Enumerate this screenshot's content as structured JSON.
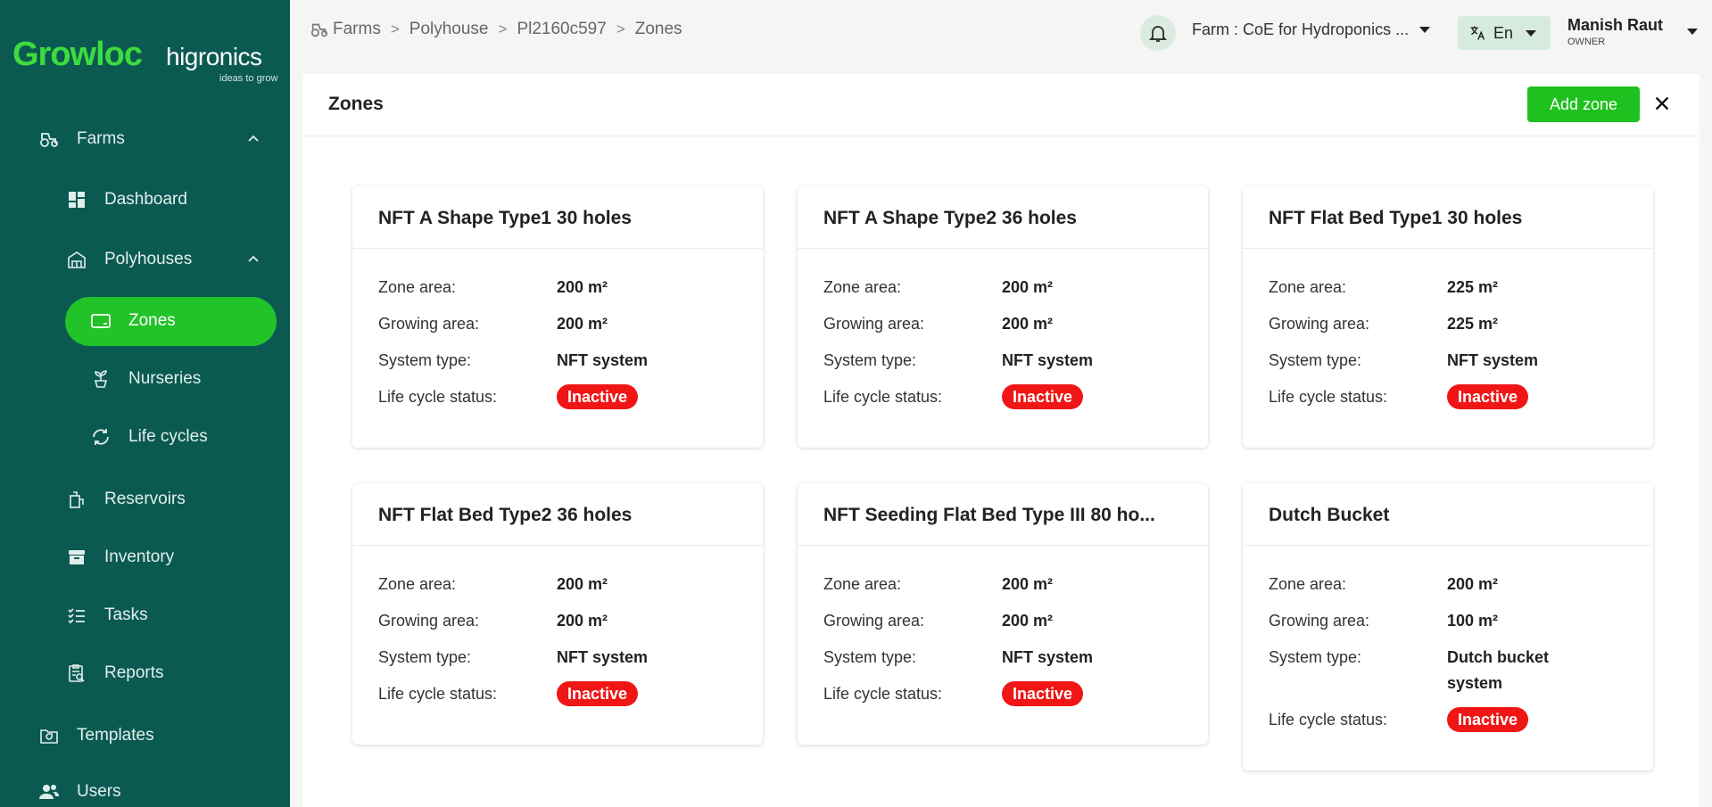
{
  "brand": {
    "name_part1": "Growloc",
    "name_part2": "higronics",
    "tagline": "ideas to grow",
    "accent": "#22c229",
    "sidebar_bg": "#0b5a52"
  },
  "sidebar": {
    "items": [
      {
        "label": "Farms",
        "icon": "tractor-icon"
      },
      {
        "label": "Dashboard",
        "icon": "dashboard-icon"
      },
      {
        "label": "Polyhouses",
        "icon": "polyhouse-icon"
      },
      {
        "label": "Zones",
        "icon": "zone-icon",
        "active": true
      },
      {
        "label": "Nurseries",
        "icon": "sprout-icon"
      },
      {
        "label": "Life cycles",
        "icon": "cycle-icon"
      },
      {
        "label": "Reservoirs",
        "icon": "reservoir-icon"
      },
      {
        "label": "Inventory",
        "icon": "archive-icon"
      },
      {
        "label": "Tasks",
        "icon": "tasks-icon"
      },
      {
        "label": "Reports",
        "icon": "report-icon"
      },
      {
        "label": "Templates",
        "icon": "template-icon"
      },
      {
        "label": "Users",
        "icon": "users-icon"
      }
    ]
  },
  "breadcrumb": [
    "Farms",
    "Polyhouse",
    "Pl2160c597",
    "Zones"
  ],
  "header": {
    "farm_label": "Farm : CoE for Hydroponics ...",
    "language": "En",
    "user_name": "Manish Raut",
    "user_role": "OWNER"
  },
  "page": {
    "title": "Zones",
    "add_button": "Add zone"
  },
  "labels": {
    "zone_area": "Zone area:",
    "growing_area": "Growing area:",
    "system_type": "System type:",
    "life_cycle_status": "Life cycle status:"
  },
  "zones": [
    {
      "name": "NFT A Shape Type1 30 holes",
      "zone_area": "200 m²",
      "growing_area": "200 m²",
      "system_type": "NFT system",
      "status": "Inactive"
    },
    {
      "name": "NFT A Shape Type2 36 holes",
      "zone_area": "200 m²",
      "growing_area": "200 m²",
      "system_type": "NFT system",
      "status": "Inactive"
    },
    {
      "name": "NFT Flat Bed Type1 30 holes",
      "zone_area": "225 m²",
      "growing_area": "225 m²",
      "system_type": "NFT system",
      "status": "Inactive"
    },
    {
      "name": "NFT Flat Bed Type2 36 holes",
      "zone_area": "200 m²",
      "growing_area": "200 m²",
      "system_type": "NFT system",
      "status": "Inactive"
    },
    {
      "name": "NFT Seeding Flat Bed Type III 80 ho...",
      "zone_area": "200 m²",
      "growing_area": "200 m²",
      "system_type": "NFT system",
      "status": "Inactive"
    },
    {
      "name": "Dutch Bucket",
      "zone_area": "200 m²",
      "growing_area": "100 m²",
      "system_type": "Dutch bucket system",
      "status": "Inactive"
    }
  ]
}
